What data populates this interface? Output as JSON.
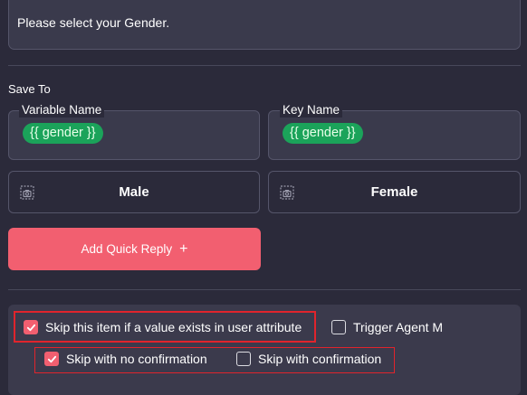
{
  "question": {
    "text": "Please select your Gender."
  },
  "save_to": {
    "title": "Save To",
    "variable": {
      "label": "Variable Name",
      "value": "{{ gender }}"
    },
    "key": {
      "label": "Key Name",
      "value": "{{ gender }}"
    }
  },
  "quick_replies": [
    {
      "label": "Male",
      "icon": "image-placeholder-icon"
    },
    {
      "label": "Female",
      "icon": "image-placeholder-icon"
    }
  ],
  "add_quick_reply": {
    "label": "Add Quick Reply",
    "icon": "plus-icon"
  },
  "options": {
    "skip_if_exists": {
      "label": "Skip this item if a value exists in user attribute",
      "checked": true
    },
    "trigger_agent": {
      "label": "Trigger Agent M",
      "checked": false
    },
    "skip_no_confirm": {
      "label": "Skip with no confirmation",
      "checked": true
    },
    "skip_confirm": {
      "label": "Skip with confirmation",
      "checked": false
    }
  },
  "colors": {
    "background": "#2b2a3a",
    "accent": "#f25f70",
    "chip": "#1ba35a",
    "highlight": "#e0242c"
  }
}
